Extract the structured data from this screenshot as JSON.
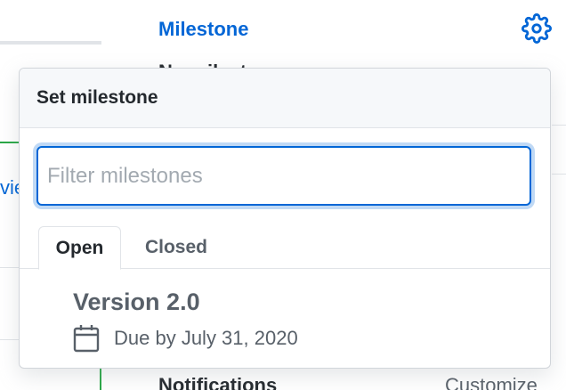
{
  "background": {
    "sidebar_heading": "Milestone",
    "peek_heading": "No milestone",
    "link_fragment": "vie",
    "notifications_heading": "Notifications",
    "customize_link": "Customize"
  },
  "popover": {
    "title": "Set milestone",
    "filter": {
      "placeholder": "Filter milestones",
      "value": ""
    },
    "tabs": [
      {
        "label": "Open",
        "selected": true
      },
      {
        "label": "Closed",
        "selected": false
      }
    ],
    "milestones": [
      {
        "title": "Version 2.0",
        "due": "Due by July 31, 2020",
        "icon": "calendar-icon"
      }
    ]
  },
  "icons": {
    "settings": "gear-icon"
  },
  "colors": {
    "accent": "#0366d6",
    "green": "#28a745",
    "muted": "#586069"
  }
}
